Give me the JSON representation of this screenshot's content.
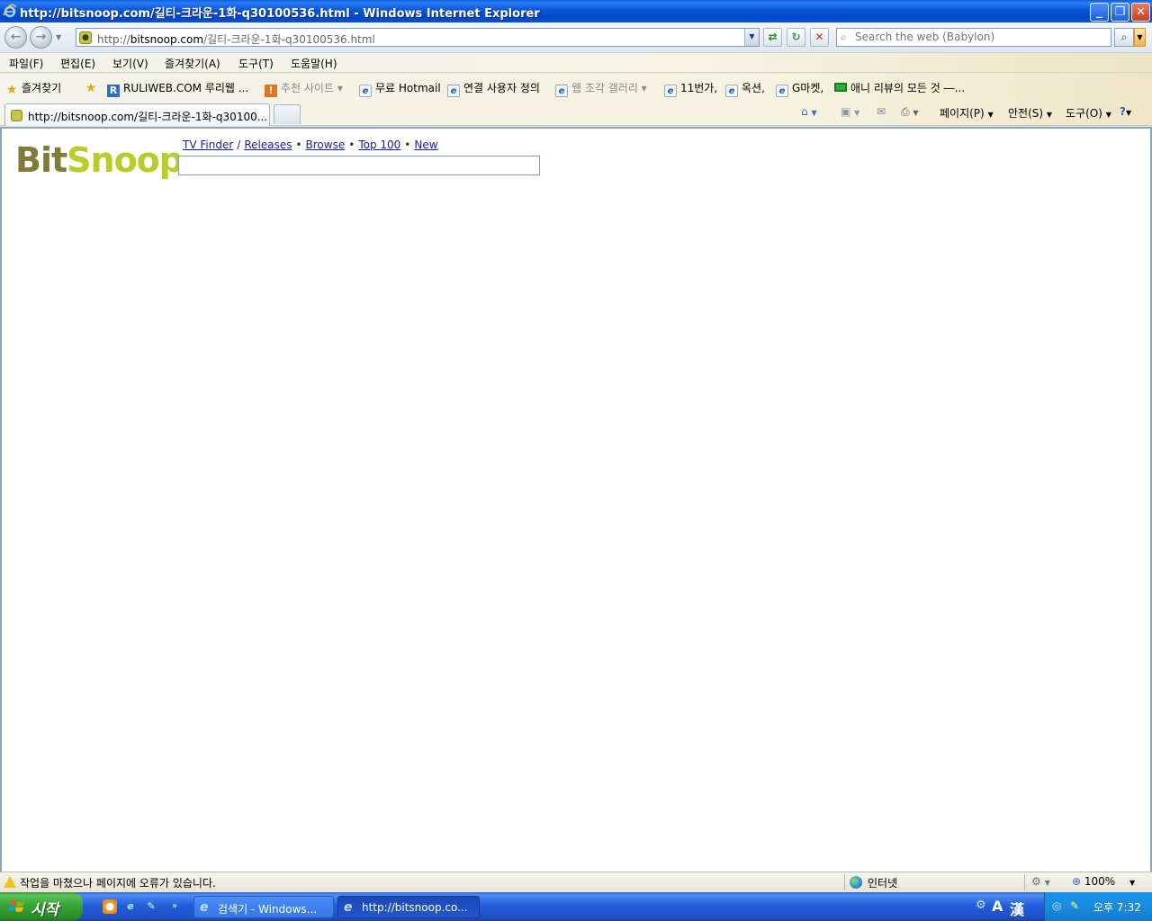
{
  "window": {
    "title": "http://bitsnoop.com/길티-크라운-1화-q30100536.html - Windows Internet Explorer"
  },
  "address_bar": {
    "url_prefix": "http://",
    "url_host": "bitsnoop.com",
    "url_path": "/길티-크라운-1화-q30100536.html"
  },
  "search": {
    "placeholder": "Search the web (Babylon)"
  },
  "menu": {
    "items": [
      "파일(F)",
      "편집(E)",
      "보기(V)",
      "즐겨찾기(A)",
      "도구(T)",
      "도움말(H)"
    ]
  },
  "favorites": {
    "label": "즐겨찾기",
    "items": [
      {
        "label": "RULIWEB.COM 루리웹 ...",
        "icon": "ruliweb-icon"
      },
      {
        "label": "추천 사이트 ▾",
        "icon": "suggested-sites-icon"
      },
      {
        "label": "무료 Hotmail",
        "icon": "ie-page-icon"
      },
      {
        "label": "연결 사용자 정의",
        "icon": "ie-page-icon"
      },
      {
        "label": "웹 조각 갤러리 ▾",
        "icon": "ie-page-icon"
      },
      {
        "label": "11번가,",
        "icon": "ie-page-icon"
      },
      {
        "label": "옥션,",
        "icon": "ie-page-icon"
      },
      {
        "label": "G마켓,",
        "icon": "ie-page-icon"
      },
      {
        "label": "애니 리뷰의 모든 것 ―...",
        "icon": "green-box-icon"
      }
    ]
  },
  "tabs": {
    "active_label": "http://bitsnoop.com/길티-크라운-1화-q30100..."
  },
  "command_bar": {
    "page": "페이지(P)",
    "safety": "안전(S)",
    "tools": "도구(O)"
  },
  "site": {
    "logo_part1": "Bit",
    "logo_part2": "Snoop",
    "nav": {
      "tv_finder": "TV Finder",
      "sep1": "/",
      "releases": "Releases",
      "sep2": "•",
      "browse": "Browse",
      "sep3": "•",
      "top100": "Top 100",
      "sep4": "•",
      "new": "New"
    },
    "search_value": ""
  },
  "status": {
    "message": "작업을 마쳤으나 페이지에 오류가 있습니다.",
    "zone": "인터넷",
    "zoom": "100%"
  },
  "taskbar": {
    "start": "시작",
    "buttons": [
      "검색기 - Windows...",
      "http://bitsnoop.co..."
    ],
    "ime": "漢",
    "ime_a": "A",
    "clock": "오후 7:32"
  },
  "colors": {
    "logo_bit": "#7f7c3a",
    "logo_snoop": "#b8cc2a",
    "link": "#1a1aa8",
    "xp_titlebar": "#0a51d6",
    "xp_start": "#35a535"
  }
}
